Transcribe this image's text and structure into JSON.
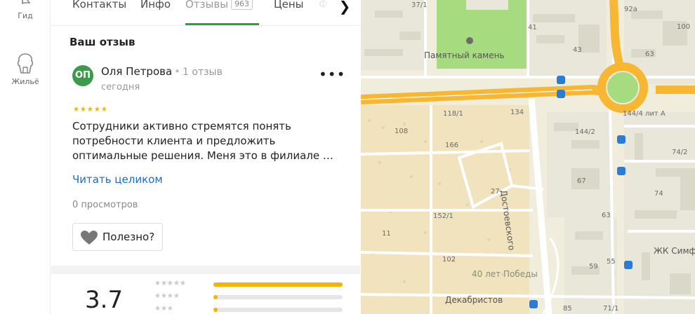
{
  "rail": {
    "guide_label": "Гид",
    "home_label": "Жильё"
  },
  "tabs": [
    {
      "label": "Контакты"
    },
    {
      "label": "Инфо"
    },
    {
      "label": "Отзывы",
      "badge": "963"
    },
    {
      "label": "Цены"
    },
    {
      "label": "Ф"
    }
  ],
  "review": {
    "section_title": "Ваш отзыв",
    "avatar_initials": "ОП",
    "author": "Оля Петрова",
    "author_reviews": "1 отзыв",
    "date": "сегодня",
    "rating_stars": 5,
    "stars_text": "★★★★★",
    "text": "Сотрудники активно стремятся понять потребности клиента и предложить оптимальные решения. Меня это в филиале …",
    "read_more": "Читать целиком",
    "views": "0 просмотров",
    "useful_label": "Полезно?"
  },
  "summary": {
    "rating": "3.7",
    "distribution": [
      {
        "stars": "★★★★★",
        "fraction": 1.0
      },
      {
        "stars": "★★★★",
        "fraction": 0.03
      },
      {
        "stars": "★★★",
        "fraction": 0.03
      }
    ]
  },
  "map": {
    "labels": {
      "l37_1": "37/1",
      "l41": "41",
      "l43": "43",
      "l92a": "92а",
      "l100": "100",
      "l63": "63",
      "memorial": "Памятный камень",
      "l118_1": "118/1",
      "l134": "134",
      "l144_4": "144/4 лит А",
      "l108": "108",
      "l144_2": "144/2",
      "l166": "166",
      "l74_2": "74/2",
      "l27": "27",
      "l67": "67",
      "street_dost": "Достоевского",
      "l74": "74",
      "l152_1": "152/1",
      "l63b": "63",
      "l11": "11",
      "l102": "102",
      "zhk": "ЖК Симф",
      "l59": "59",
      "l55": "55",
      "pobedy": "40 лет Победы",
      "decembrists": "Декабристов",
      "l85": "85",
      "l71_1": "71/1"
    },
    "colors": {
      "road": "#f7b733",
      "park": "#a7db7f",
      "block": "#e8e7da",
      "residential": "#f2e3bf",
      "transit": "#2b7cd3"
    }
  }
}
